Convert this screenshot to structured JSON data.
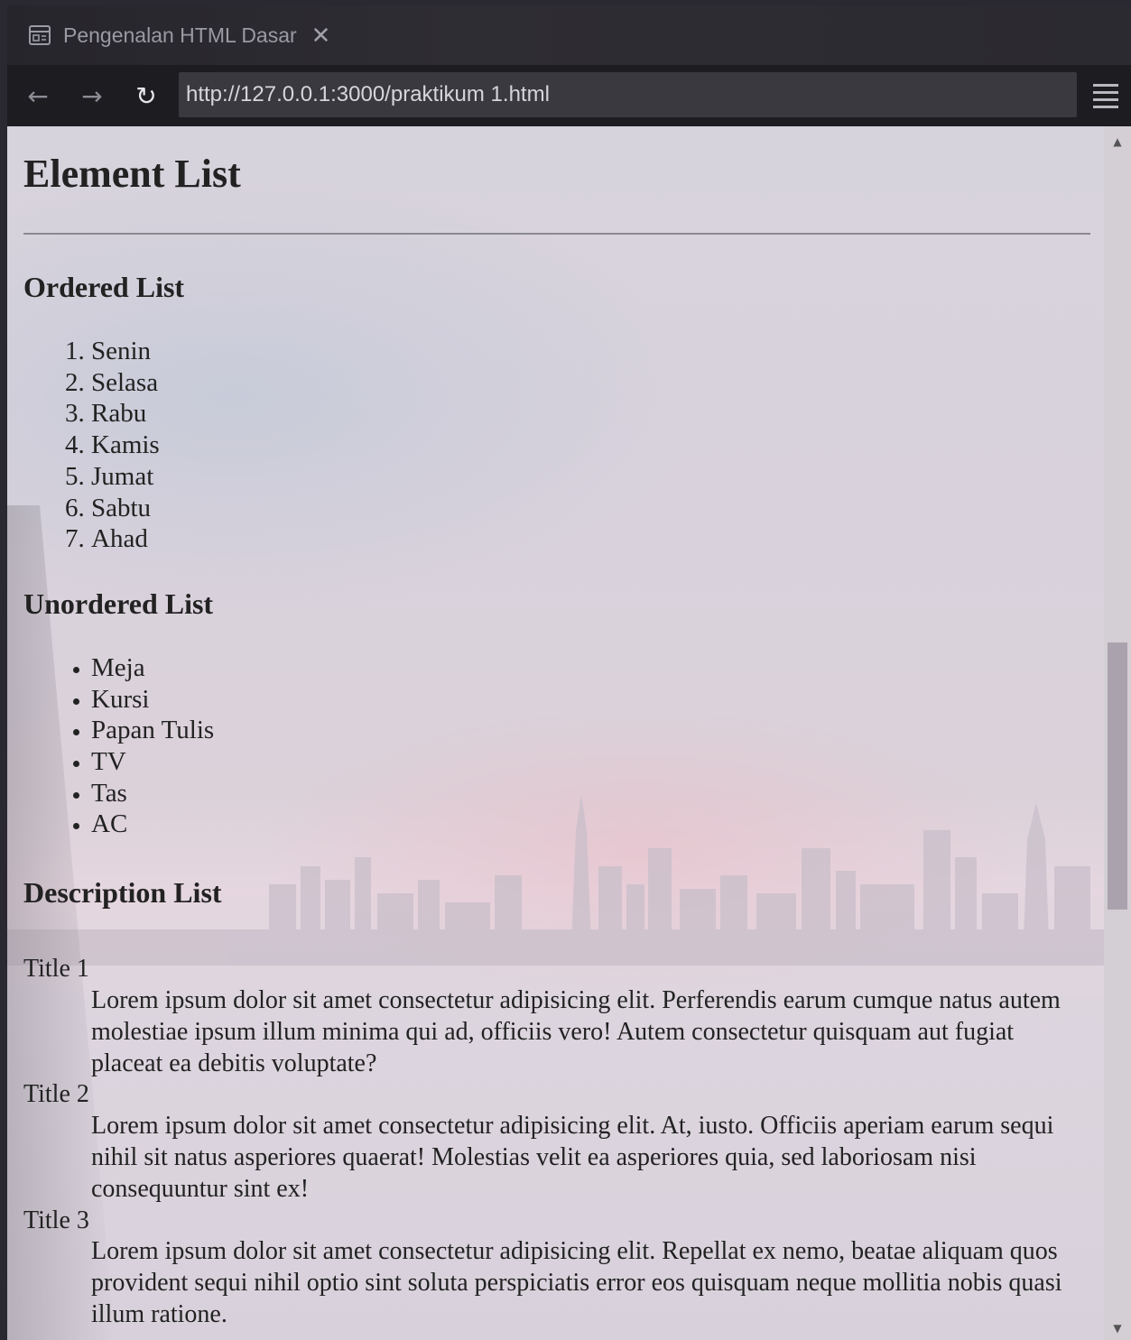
{
  "browser": {
    "tab": {
      "title": "Pengenalan HTML Dasar",
      "icon": "browser-tab-icon",
      "close_icon": "close-icon"
    },
    "nav": {
      "back_icon": "back-arrow-icon",
      "forward_icon": "forward-arrow-icon",
      "reload_icon": "reload-icon",
      "url": "http://127.0.0.1:3000/praktikum 1.html",
      "menu_icon": "hamburger-menu-icon"
    }
  },
  "page": {
    "title": "Element List",
    "ordered": {
      "heading": "Ordered List",
      "items": [
        "Senin",
        "Selasa",
        "Rabu",
        "Kamis",
        "Jumat",
        "Sabtu",
        "Ahad"
      ]
    },
    "unordered": {
      "heading": "Unordered List",
      "items": [
        "Meja",
        "Kursi",
        "Papan Tulis",
        "TV",
        "Tas",
        "AC"
      ]
    },
    "description": {
      "heading": "Description List",
      "items": [
        {
          "term": "Title 1",
          "desc": "Lorem ipsum dolor sit amet consectetur adipisicing elit. Perferendis earum cumque natus autem molestiae ipsum illum minima qui ad, officiis vero! Autem consectetur quisquam aut fugiat placeat ea debitis voluptate?"
        },
        {
          "term": "Title 2",
          "desc": "Lorem ipsum dolor sit amet consectetur adipisicing elit. At, iusto. Officiis aperiam earum sequi nihil sit natus asperiores quaerat! Molestias velit ea asperiores quia, sed laboriosam nisi consequuntur sint ex!"
        },
        {
          "term": "Title 3",
          "desc": "Lorem ipsum dolor sit amet consectetur adipisicing elit. Repellat ex nemo, beatae aliquam quos provident sequi nihil optio sint soluta perspiciatis error eos quisquam neque mollitia nobis quasi illum ratione."
        }
      ]
    }
  },
  "colors": {
    "chrome_dark": "#1d1c21",
    "url_bar": "#3a393f",
    "page_text": "#222222",
    "scroll_thumb": "#aaa3ad"
  }
}
